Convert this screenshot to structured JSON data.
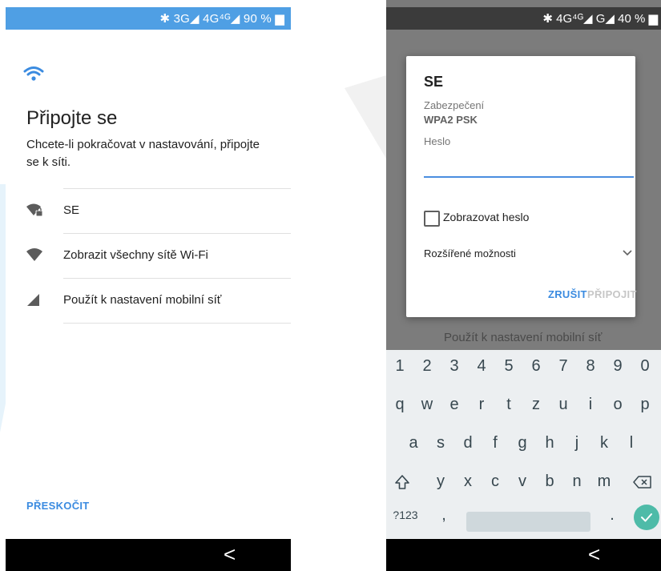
{
  "left_screen": {
    "status_text": "✱ 3G◢ 4G⁴ᴳ◢ 90 % ▆",
    "title": "Připojte se",
    "subtitle": "Chcete-li pokračovat v nastavování, připojte se k síti.",
    "options": [
      {
        "label": "SE",
        "icon": "wifi-locked-icon"
      },
      {
        "label": "Zobrazit všechny sítě Wi-Fi",
        "icon": "wifi-icon"
      },
      {
        "label": "Použít k nastavení mobilní síť",
        "icon": "cellular-icon"
      }
    ],
    "skip_label": "PŘESKOČIT",
    "back_glyph": "<"
  },
  "right_screen": {
    "status_text": "✱ 4G⁴ᴳ◢ G◢ 40 % ▆",
    "dialog": {
      "network_name": "SE",
      "security_label": "Zabezpečení",
      "security_value": "WPA2 PSK",
      "password_label": "Heslo",
      "password_value": "",
      "show_password_label": "Zobrazovat heslo",
      "show_password_checked": false,
      "advanced_label": "Rozšířené možnosti",
      "cancel_label": "ZRUŠIT",
      "connect_label": "PŘIPOJIT"
    },
    "background_text": "Použít k nastavení mobilní síť",
    "keyboard": {
      "row1": [
        "1",
        "2",
        "3",
        "4",
        "5",
        "6",
        "7",
        "8",
        "9",
        "0"
      ],
      "row2": [
        "q",
        "w",
        "e",
        "r",
        "t",
        "z",
        "u",
        "i",
        "o",
        "p"
      ],
      "row3": [
        "a",
        "s",
        "d",
        "f",
        "g",
        "h",
        "j",
        "k",
        "l"
      ],
      "row4": [
        "y",
        "x",
        "c",
        "v",
        "b",
        "n",
        "m"
      ],
      "symbols_key": "?123",
      "comma_key": ",",
      "period_key": "."
    },
    "back_glyph": "<"
  },
  "colors": {
    "accent": "#3b8be0",
    "status_left": "#4f9fe4",
    "enter_key": "#4ebba8"
  }
}
